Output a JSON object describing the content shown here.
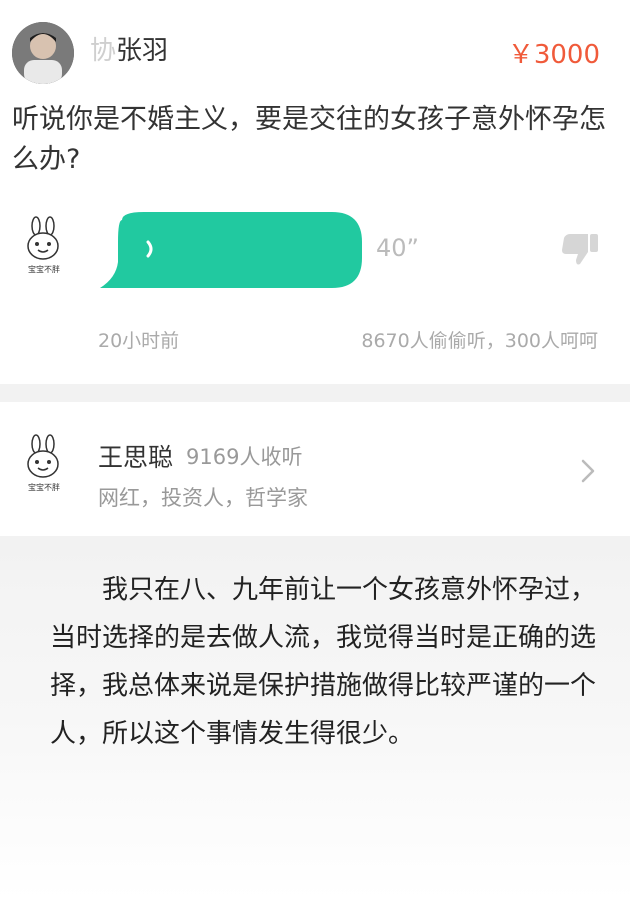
{
  "question": {
    "asker_name_blurred": "协",
    "asker_name": "张羽",
    "price": "￥3000",
    "text": "听说你是不婚主义，要是交往的女孩子意外怀孕怎么办?",
    "voice_duration": "40”",
    "time_ago": "20小时前",
    "stats": "8670人偷偷听，300人呵呵",
    "accent_color": "#21c9a0",
    "price_color": "#f05a3a"
  },
  "answerer": {
    "name": "王思聪",
    "listen_count": "9169人收听",
    "tags": "网红，投资人，哲学家",
    "avatar_caption": "宝宝不胖"
  },
  "answer": {
    "text": "我只在八、九年前让一个女孩意外怀孕过，当时选择的是去做人流，我觉得当时是正确的选择，我总体来说是保护措施做得比较严谨的一个人，所以这个事情发生得很少。"
  },
  "icons": {
    "avatar": "person-photo",
    "small_avatar": "rabbit-sticker-icon",
    "voice": "voice-wave-icon",
    "dislike": "thumbs-down-icon",
    "more": "chevron-right-icon"
  }
}
